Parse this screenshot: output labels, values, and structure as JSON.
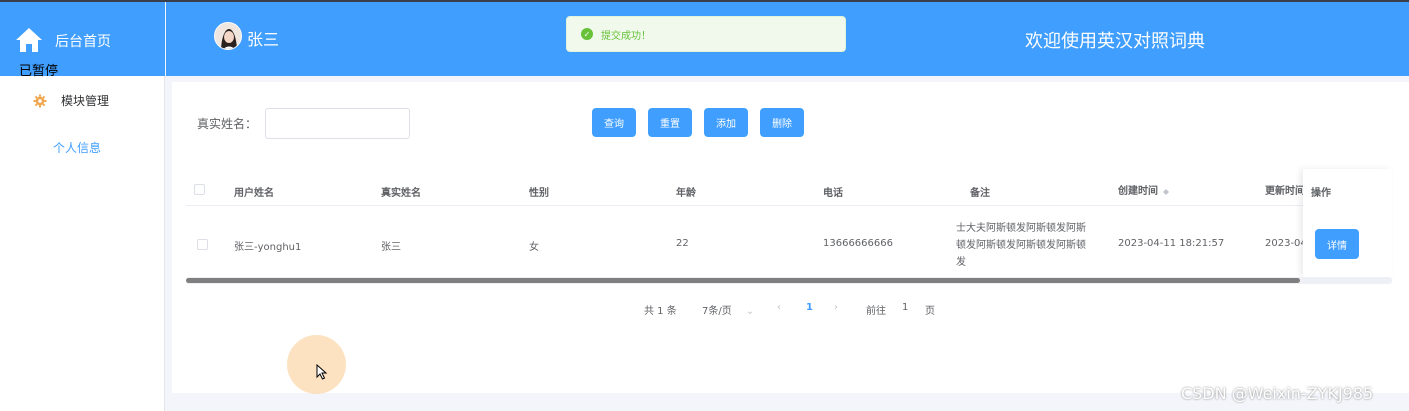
{
  "sidebar": {
    "title": "后台首页",
    "overlay_text": "已暂停",
    "menu": [
      {
        "label": "模块管理",
        "icon": "gear-icon"
      },
      {
        "label": "个人信息"
      }
    ]
  },
  "header": {
    "username": "张三",
    "welcome": "欢迎使用英汉对照词典",
    "toast": "提交成功！"
  },
  "search": {
    "label": "真实姓名：",
    "value": "",
    "buttons": [
      "查询",
      "重置",
      "添加",
      "删除"
    ]
  },
  "table": {
    "columns": [
      "用户姓名",
      "真实姓名",
      "性别",
      "年龄",
      "电话",
      "备注",
      "创建时间",
      "更新时间",
      "操作"
    ],
    "rows": [
      {
        "username": "张三-yonghu1",
        "realname": "张三",
        "gender": "女",
        "age": "22",
        "phone": "13666666666",
        "remark": "士大夫阿斯顿发阿斯顿发阿斯顿发阿斯顿发阿斯顿发阿斯顿发",
        "created": "2023-04-11 18:21:57",
        "updated": "2023-04",
        "action": "详情"
      }
    ]
  },
  "pagination": {
    "total": "共 1 条",
    "page_size": "7条/页",
    "current_page": "1",
    "goto_label": "前往",
    "goto_value": "1",
    "page_suffix": "页"
  },
  "watermark": "CSDN @Weixin-ZYKJ985",
  "colors": {
    "primary": "#409eff",
    "success": "#67c23a"
  }
}
